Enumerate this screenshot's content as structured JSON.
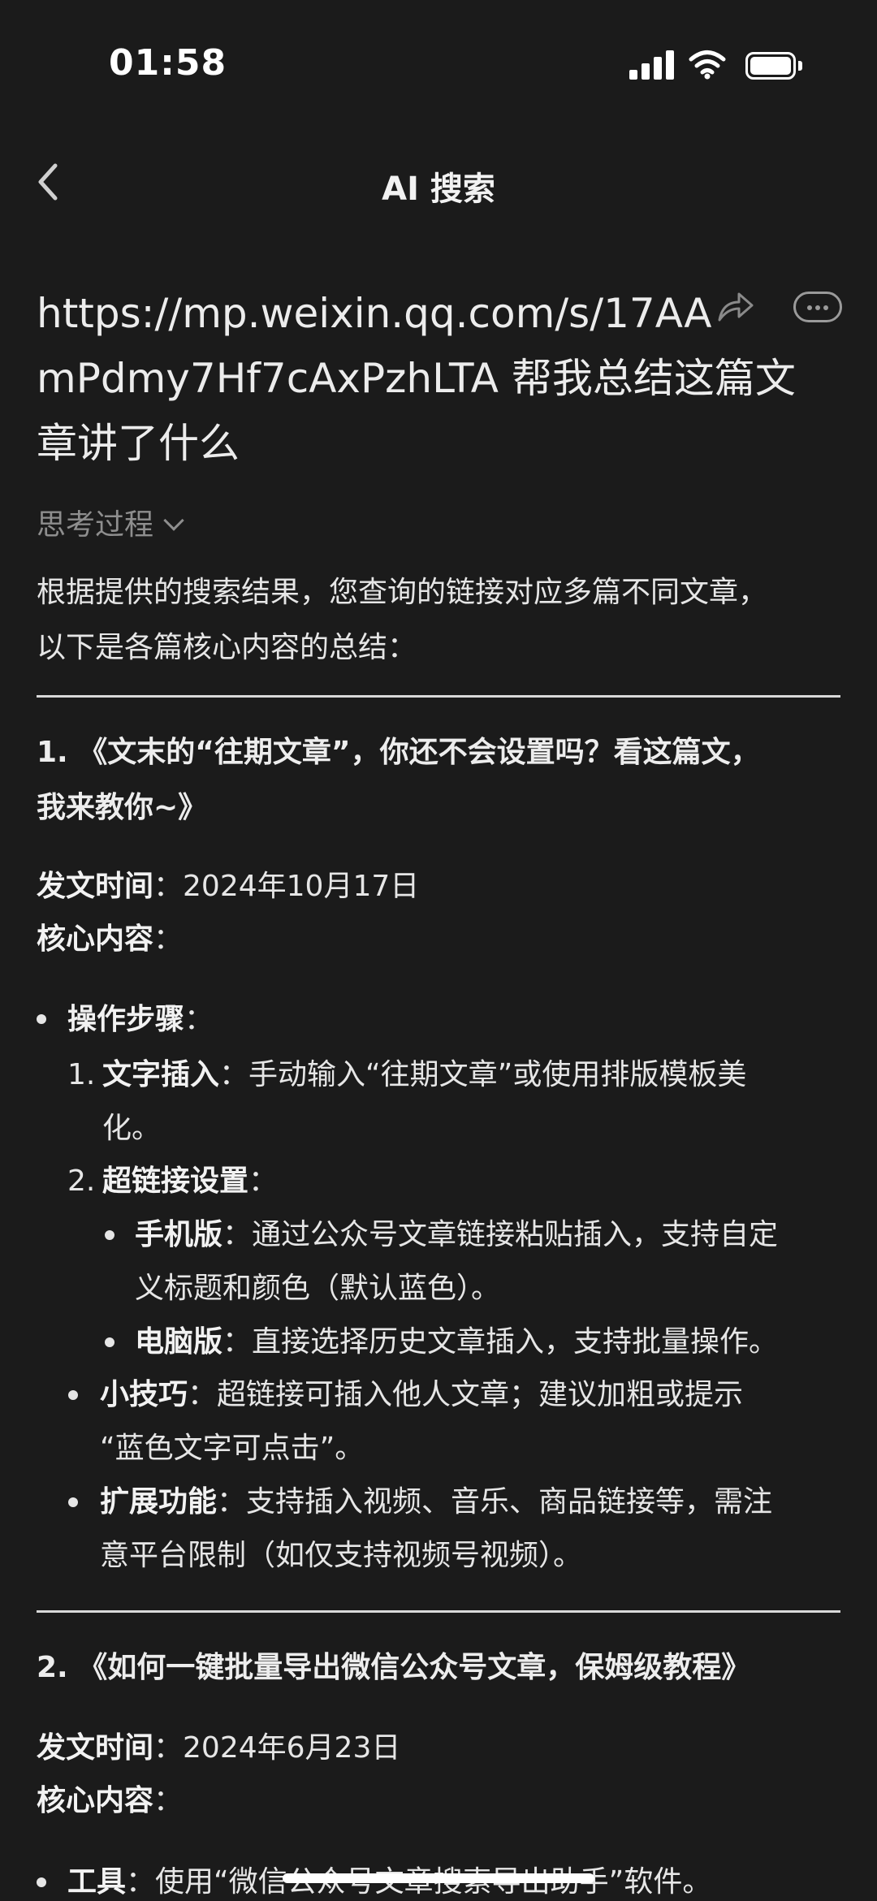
{
  "status_bar": {
    "time": "01:58"
  },
  "nav": {
    "title": "AI 搜索"
  },
  "query": {
    "line1": "https://mp.weixin.qq.com/s/17AA",
    "line2": "mPdmy7Hf7cAxPzhLTA 帮我总结这篇文",
    "line3": "章讲了什么"
  },
  "thinking": {
    "label": "思考过程"
  },
  "intro": {
    "line1": "根据提供的搜索结果，您查询的链接对应多篇不同文章，",
    "line2": "以下是各篇核心内容的总结："
  },
  "article1": {
    "title_line1": "1. 《文末的“往期文章”，你还不会设置吗？看这篇文，",
    "title_line2": "我来教你~》",
    "date_label": "发文时间",
    "date_value": "：2024年10月17日",
    "core_label": "核心内容",
    "core_suffix": "：",
    "steps_label": "操作步骤",
    "steps_suffix": "：",
    "step1_num": "1.",
    "step1_label": "文字插入",
    "step1_text": "：手动输入“往期文章”或使用排版模板美",
    "step1_text2": "化。",
    "step2_num": "2.",
    "step2_label": "超链接设置",
    "step2_suffix": "：",
    "mobile_label": "手机版",
    "mobile_text": "：通过公众号文章链接粘贴插入，支持自定",
    "mobile_text2": "义标题和颜色（默认蓝色）。",
    "pc_label": "电脑版",
    "pc_text": "：直接选择历史文章插入，支持批量操作。",
    "tips_label": "小技巧",
    "tips_text": "：超链接可插入他人文章；建议加粗或提示",
    "tips_text2": "“蓝色文字可点击”。",
    "ext_label": "扩展功能",
    "ext_text": "：支持插入视频、音乐、商品链接等，需注",
    "ext_text2": "意平台限制（如仅支持视频号视频）。"
  },
  "article2": {
    "title": "2. 《如何一键批量导出微信公众号文章，保姆级教程》",
    "date_label": "发文时间",
    "date_value": "：2024年6月23日",
    "core_label": "核心内容",
    "core_suffix": "：",
    "tool_label": "工具",
    "tool_text": "：使用“微信公众号文章搜索导出助手”软件。"
  }
}
